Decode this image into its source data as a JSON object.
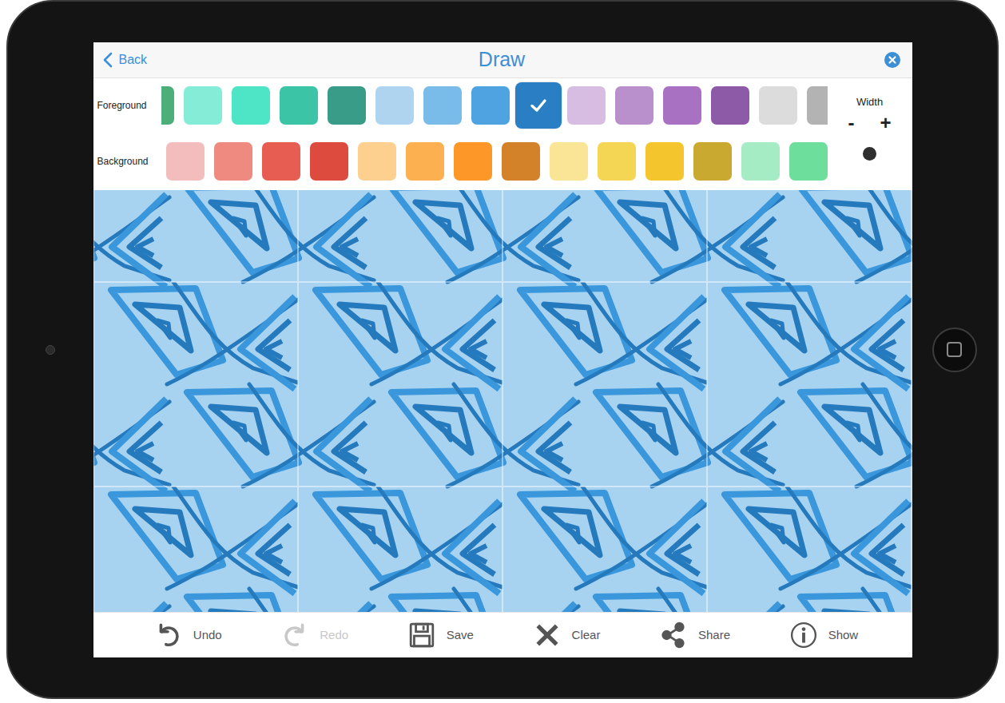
{
  "nav": {
    "back": "Back",
    "title": "Draw"
  },
  "foreground": {
    "label": "Foreground",
    "swatches": [
      {
        "color": "#4caf7a",
        "selected": false
      },
      {
        "color": "#85ecd8",
        "selected": false
      },
      {
        "color": "#4de5c6",
        "selected": false
      },
      {
        "color": "#3cc4a6",
        "selected": false
      },
      {
        "color": "#389c88",
        "selected": false
      },
      {
        "color": "#afd4ef",
        "selected": false
      },
      {
        "color": "#79bbe9",
        "selected": false
      },
      {
        "color": "#4ea3e0",
        "selected": false
      },
      {
        "color": "#2a7fc4",
        "selected": true
      },
      {
        "color": "#d8bde2",
        "selected": false
      },
      {
        "color": "#b98fcc",
        "selected": false
      },
      {
        "color": "#a871c2",
        "selected": false
      },
      {
        "color": "#8d5aa7",
        "selected": false
      },
      {
        "color": "#dcdcdc",
        "selected": false
      },
      {
        "color": "#b3b3b3",
        "selected": false
      }
    ]
  },
  "background": {
    "label": "Background",
    "swatches": [
      {
        "color": "#f4bdbd",
        "selected": false
      },
      {
        "color": "#ef8a80",
        "selected": false
      },
      {
        "color": "#e85d52",
        "selected": false
      },
      {
        "color": "#dc4b3e",
        "selected": false
      },
      {
        "color": "#fdd08f",
        "selected": false
      },
      {
        "color": "#fcb04f",
        "selected": false
      },
      {
        "color": "#fd9727",
        "selected": false
      },
      {
        "color": "#d38229",
        "selected": false
      },
      {
        "color": "#fae597",
        "selected": false
      },
      {
        "color": "#f5d554",
        "selected": false
      },
      {
        "color": "#f4c52c",
        "selected": false
      },
      {
        "color": "#c9a930",
        "selected": false
      },
      {
        "color": "#a5ebc3",
        "selected": false
      },
      {
        "color": "#6ede9c",
        "selected": false
      }
    ]
  },
  "width": {
    "label": "Width",
    "minus": "-",
    "plus": "+"
  },
  "toolbar": [
    {
      "label": "Undo",
      "kind": "undo",
      "disabled": false
    },
    {
      "label": "Redo",
      "kind": "redo",
      "disabled": true
    },
    {
      "label": "Save",
      "kind": "save",
      "disabled": false
    },
    {
      "label": "Clear",
      "kind": "clear",
      "disabled": false
    },
    {
      "label": "Share",
      "kind": "share",
      "disabled": false
    },
    {
      "label": "Show",
      "kind": "show",
      "disabled": false
    }
  ]
}
